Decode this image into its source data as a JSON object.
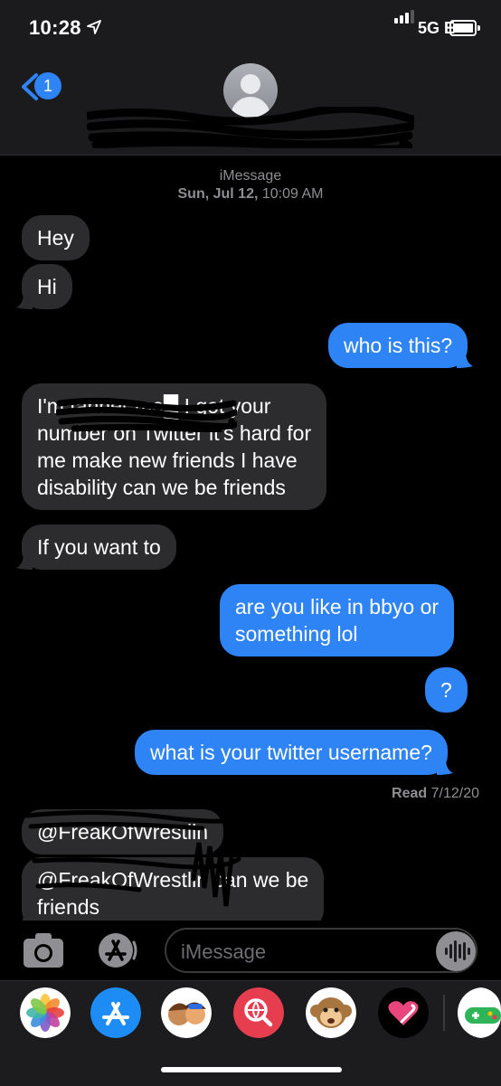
{
  "status_bar": {
    "time": "10:28",
    "network": "5G E"
  },
  "nav": {
    "back_badge": "1"
  },
  "thread": {
    "service": "iMessage",
    "timestamp_day": "Sun, Jul 12,",
    "timestamp_time": "10:09 AM"
  },
  "messages": [
    {
      "from": "them",
      "lines": [
        "Hey"
      ]
    },
    {
      "from": "them",
      "lines": [
        "Hi"
      ]
    },
    {
      "from": "me",
      "lines": [
        "who is this?"
      ]
    },
    {
      "from": "them",
      "lines": [
        "I'm tanner mo█ I got your",
        "number on Twitter it's hard for",
        "me make new friends I have",
        "disability can we be friends"
      ]
    },
    {
      "from": "them",
      "lines": [
        "If you want to"
      ]
    },
    {
      "from": "me",
      "lines": [
        "are you like in bbyo or",
        "something lol"
      ]
    },
    {
      "from": "me",
      "lines": [
        "?"
      ]
    },
    {
      "from": "me",
      "lines": [
        "what is your twitter username?"
      ]
    },
    {
      "from": "them",
      "lines": [
        "@FreakOfWrestlin"
      ]
    },
    {
      "from": "them",
      "lines": [
        "@FreakOfWrestlin can we be",
        "friends"
      ]
    }
  ],
  "receipt": {
    "label": "Read",
    "date": "7/12/20"
  },
  "compose": {
    "placeholder": "iMessage"
  },
  "icons": {
    "back": "chevron-left-icon",
    "camera": "camera-icon",
    "app_store": "app-store-icon",
    "audio": "audio-waveform-icon"
  },
  "app_drawer": [
    "photos",
    "app-store",
    "memoji-stickers",
    "web-search",
    "animoji",
    "digital-touch",
    "game-app"
  ],
  "colors": {
    "bubble_out": "#2f84f5",
    "bubble_in": "#2c2c2e",
    "accent": "#2f84f5"
  }
}
